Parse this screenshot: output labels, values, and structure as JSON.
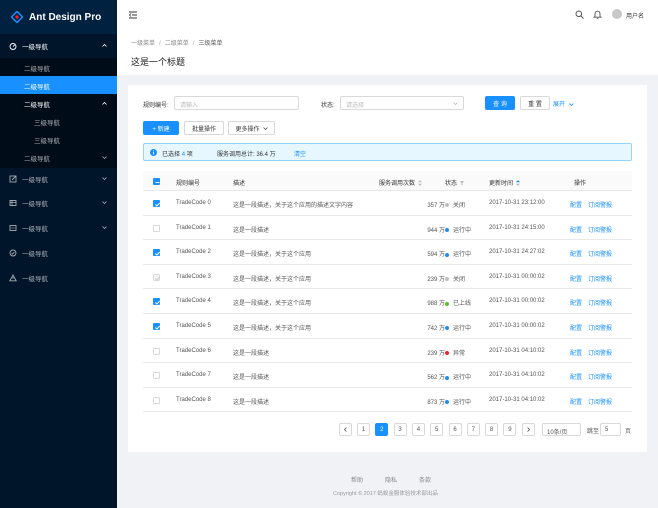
{
  "app": {
    "title": "Ant Design Pro"
  },
  "sidebar": {
    "items": [
      {
        "label": "一级导航",
        "icon": "dashboard-icon",
        "level": 1,
        "open": true
      },
      {
        "label": "二级导航",
        "level": 2
      },
      {
        "label": "二级导航",
        "level": 2,
        "active": true
      },
      {
        "label": "二级导航",
        "level": 2,
        "open": true
      },
      {
        "label": "三级导航",
        "level": 3
      },
      {
        "label": "三级导航",
        "level": 3
      },
      {
        "label": "二级导航",
        "level": 2
      },
      {
        "label": "一级导航",
        "icon": "form-icon",
        "level": 1
      },
      {
        "label": "一级导航",
        "icon": "table-icon",
        "level": 1
      },
      {
        "label": "一级导航",
        "icon": "profile-icon",
        "level": 1
      },
      {
        "label": "一级导航",
        "icon": "check-circle-icon",
        "level": 1
      },
      {
        "label": "一级导航",
        "icon": "warning-icon",
        "level": 1
      }
    ]
  },
  "header": {
    "username": "用户名"
  },
  "page": {
    "breadcrumb": [
      "一级菜单",
      "二级菜单",
      "三级菜单"
    ],
    "title": "这是一个标题"
  },
  "filters": {
    "rule_label": "规则编号:",
    "rule_placeholder": "请输入",
    "status_label": "状态:",
    "status_placeholder": "请选择",
    "query_button": "查 询",
    "reset_button": "重 置",
    "expand_link": "展开"
  },
  "toolbar": {
    "new_button": "+ 新建",
    "batch_button": "批量操作",
    "more_button": "更多操作"
  },
  "alert": {
    "selected_prefix": "已选择",
    "selected_count": "4",
    "selected_suffix": "项",
    "total_text": "服务调用总计: 36.4 万",
    "clear_link": "清空"
  },
  "table": {
    "columns": [
      "规则编号",
      "描述",
      "服务调用次数",
      "状态",
      "更新时间",
      "操作"
    ],
    "actions": [
      "配置",
      "订阅警报"
    ],
    "rows": [
      {
        "code": "TradeCode 0",
        "desc": "这是一段描述，关于这个应用的描述文字内容",
        "calls": "357 万",
        "status": "关闭",
        "status_color": "#bfbfbf",
        "time": "2017-10-31  23:12:00",
        "checked": true
      },
      {
        "code": "TradeCode 1",
        "desc": "这是一段描述",
        "calls": "944 万",
        "status": "运行中",
        "status_color": "#1890ff",
        "time": "2017-10-31  24:15:00",
        "checked": false
      },
      {
        "code": "TradeCode 2",
        "desc": "这是一段描述，关于这个应用",
        "calls": "594 万",
        "status": "运行中",
        "status_color": "#1890ff",
        "time": "2017-10-31  24:27:02",
        "checked": true
      },
      {
        "code": "TradeCode 3",
        "desc": "这是一段描述，关于这个应用",
        "calls": "239 万",
        "status": "关闭",
        "status_color": "#bfbfbf",
        "time": "2017-10-31  00:00:02",
        "checked": false,
        "disabled": true
      },
      {
        "code": "TradeCode 4",
        "desc": "这是一段描述，关于这个应用",
        "calls": "988 万",
        "status": "已上线",
        "status_color": "#52c41a",
        "time": "2017-10-31  00:00:02",
        "checked": true
      },
      {
        "code": "TradeCode 5",
        "desc": "这是一段描述，关于这个应用",
        "calls": "742 万",
        "status": "运行中",
        "status_color": "#1890ff",
        "time": "2017-10-31  00:00:02",
        "checked": true
      },
      {
        "code": "TradeCode 6",
        "desc": "这是一段描述",
        "calls": "239 万",
        "status": "异常",
        "status_color": "#f5222d",
        "time": "2017-10-31  04:10:02",
        "checked": false
      },
      {
        "code": "TradeCode 7",
        "desc": "这是一段描述",
        "calls": "562 万",
        "status": "运行中",
        "status_color": "#1890ff",
        "time": "2017-10-31  04:10:02",
        "checked": false
      },
      {
        "code": "TradeCode 8",
        "desc": "这是一段描述",
        "calls": "873 万",
        "status": "运行中",
        "status_color": "#1890ff",
        "time": "2017-10-31  04:10:02",
        "checked": false
      }
    ]
  },
  "pagination": {
    "pages": [
      "1",
      "2",
      "3",
      "4",
      "5",
      "6",
      "7",
      "8",
      "9"
    ],
    "current": "2",
    "page_size": "10条/页",
    "jump_label": "跳至",
    "jump_value": "5",
    "jump_suffix": "页"
  },
  "footer": {
    "links": [
      "帮助",
      "隐私",
      "条款"
    ],
    "copyright": "Copyright  © 2017 蚂蚁金服体验技术部出品"
  },
  "colors": {
    "primary": "#1890ff",
    "sider": "#001529"
  }
}
